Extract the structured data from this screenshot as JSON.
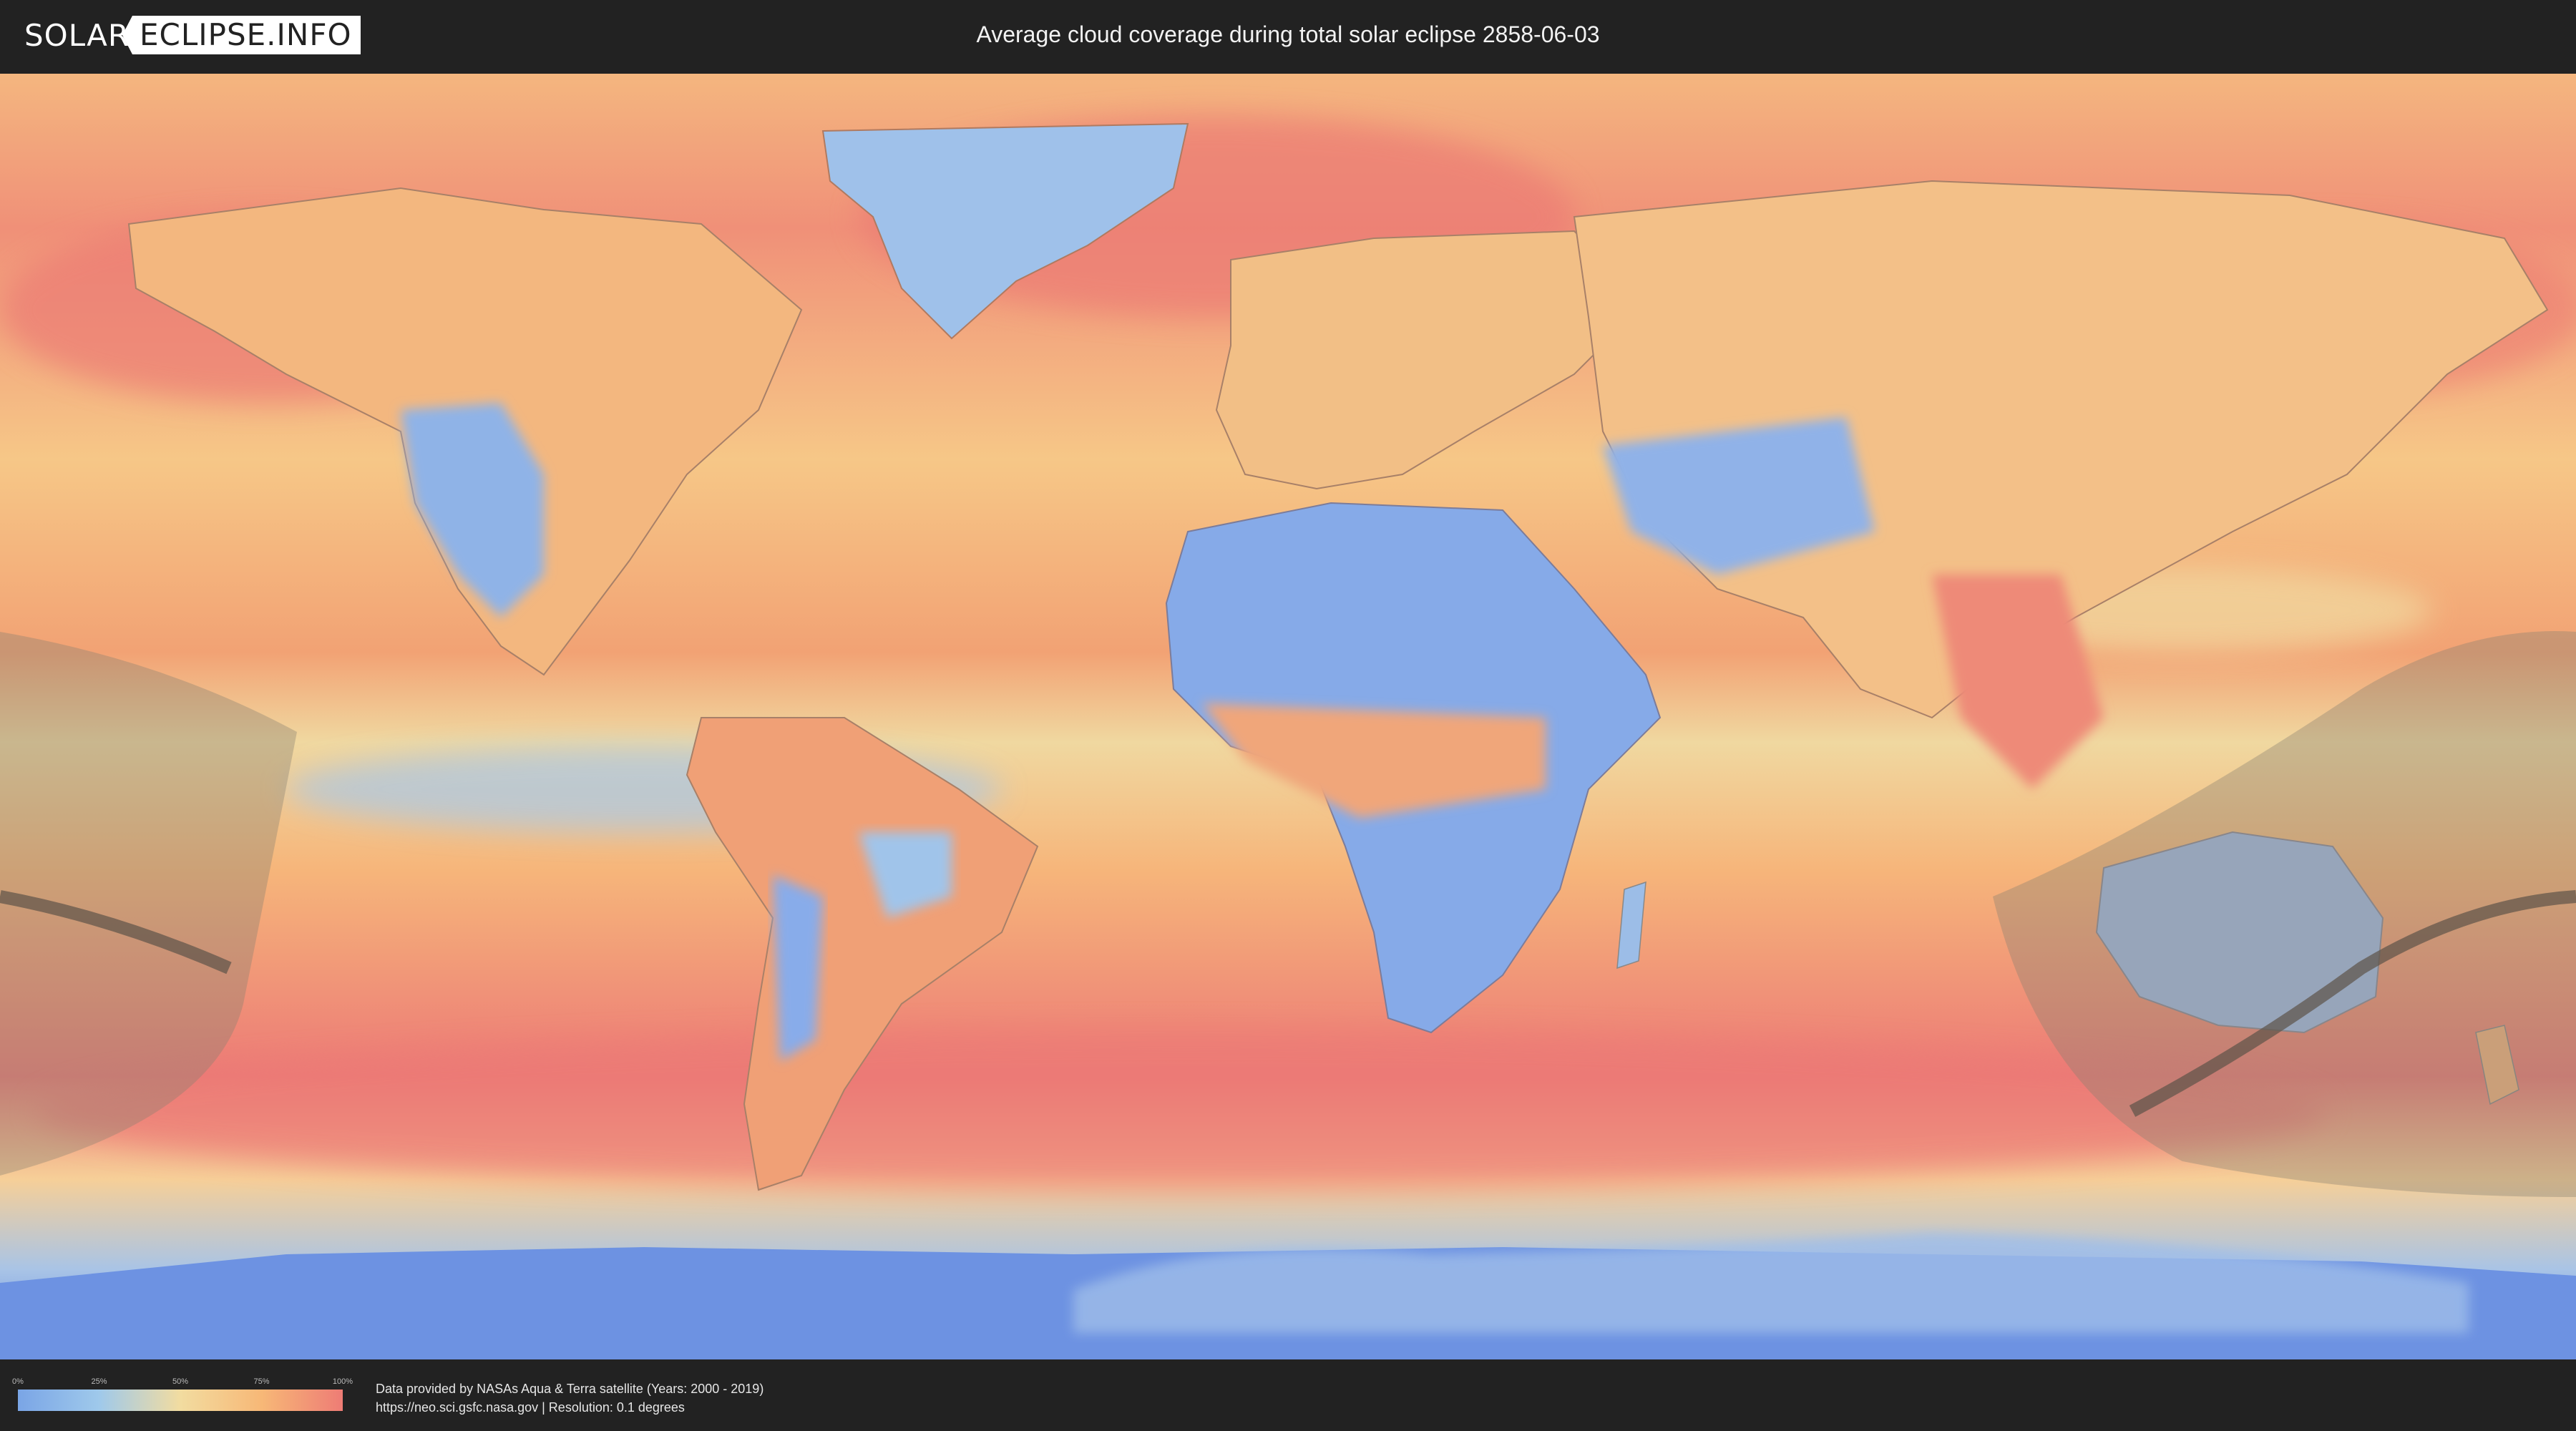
{
  "header": {
    "logo_left": "SOLAR",
    "logo_right": "ECLIPSE.INFO",
    "title": "Average cloud coverage during total solar eclipse 2858-06-03"
  },
  "map": {
    "label": "Cloud coverage world map",
    "land_icon": "continent-outline-icon",
    "colors": {
      "ocean": "#f3a872",
      "dense_cloud": "#ec7a76",
      "clear": "#7ea6e5",
      "ice": "#5b84e0",
      "shadow": "#8a8070"
    }
  },
  "legend": {
    "ticks": [
      "0%",
      "25%",
      "50%",
      "75%",
      "100%"
    ],
    "colors": [
      "#7aa5e6",
      "#9fc9eb",
      "#f2dca0",
      "#f7b877",
      "#ee7c75"
    ]
  },
  "credits": {
    "line1": "Data provided by NASAs Aqua & Terra satellite (Years: 2000 - 2019)",
    "line2": "https://neo.sci.gsfc.nasa.gov | Resolution: 0.1 degrees"
  }
}
